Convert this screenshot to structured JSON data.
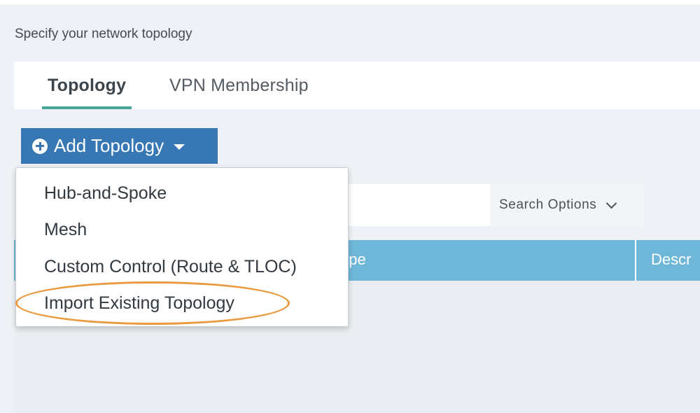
{
  "page": {
    "title": "Specify your network topology"
  },
  "tabs": [
    {
      "label": "Topology",
      "active": true
    },
    {
      "label": "VPN Membership",
      "active": false
    }
  ],
  "add_topology": {
    "label": "Add Topology",
    "icon": "plus-circle-icon",
    "caret_icon": "caret-down-icon",
    "color": "#3677b4"
  },
  "dropdown": {
    "items": [
      {
        "label": "Hub-and-Spoke"
      },
      {
        "label": "Mesh"
      },
      {
        "label": "Custom Control (Route & TLOC)"
      },
      {
        "label": "Import Existing Topology",
        "highlighted": true
      }
    ]
  },
  "search": {
    "options_label": "Search Options",
    "chevron_icon": "chevron-down-icon"
  },
  "table": {
    "columns": [
      {
        "label": "Type"
      },
      {
        "label": "Descr"
      }
    ],
    "header_color": "#6fb7d8"
  },
  "colors": {
    "active_tab_underline": "#46a798",
    "highlight_ellipse": "#ea9a3e"
  }
}
